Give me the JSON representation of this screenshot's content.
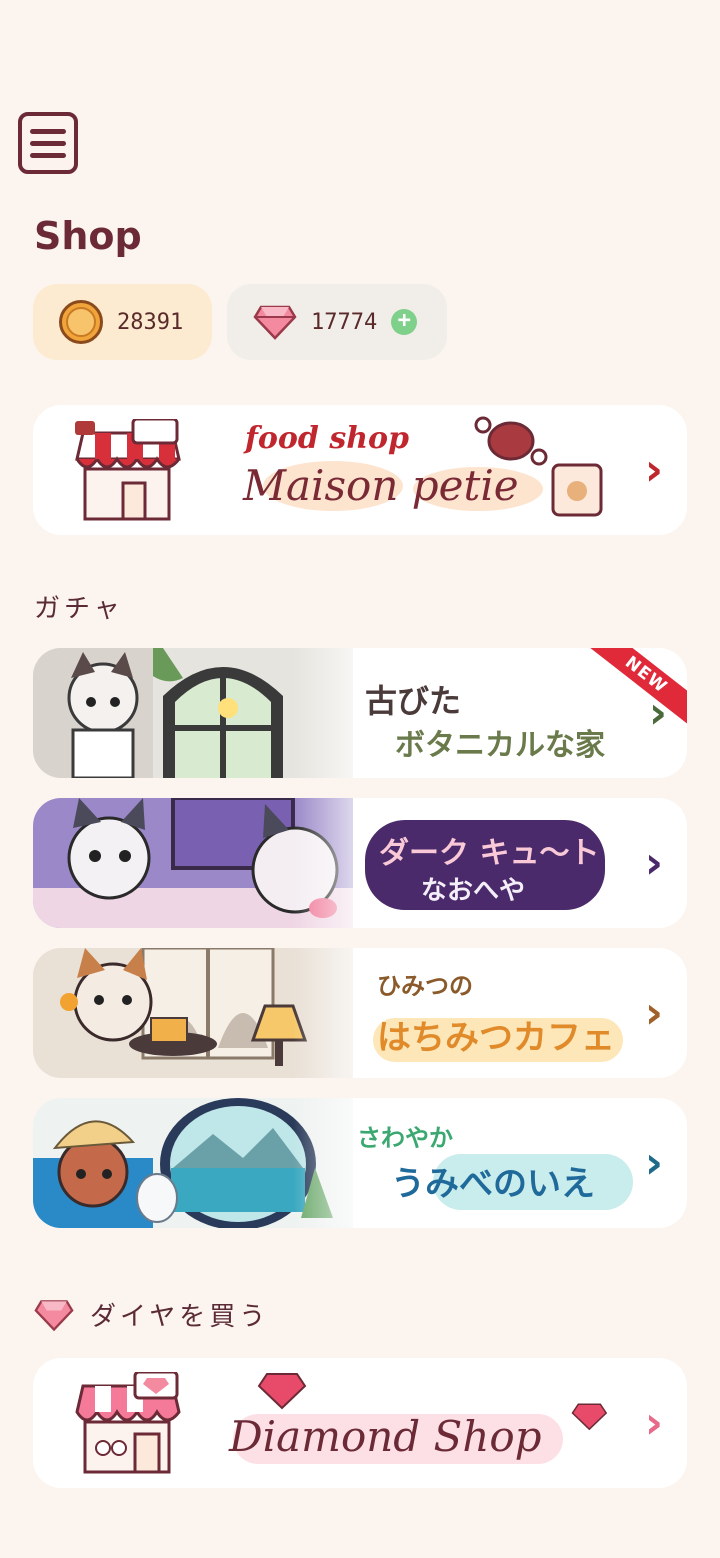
{
  "page": {
    "title": "Shop"
  },
  "currency": {
    "coins": "28391",
    "diamonds": "17774",
    "add_label": "+"
  },
  "food_shop": {
    "small_title": "food shop",
    "big_title": "Maison petie",
    "chevron": "›"
  },
  "gacha": {
    "section_label": "ガチャ",
    "items": [
      {
        "title_line1": "古びた",
        "title_line2": "ボタニカルな家",
        "badge": "NEW",
        "chevron": "›",
        "accent": "#4b6a3a"
      },
      {
        "title_line1": "ダーク キュ～ト",
        "title_line2": "なおへや",
        "chevron": "›",
        "accent": "#4a2a6a"
      },
      {
        "title_line1": "ひみつの",
        "title_line2": "はちみつカフェ",
        "chevron": "›",
        "accent": "#a0602a"
      },
      {
        "title_line1": "さわやか",
        "title_line2": "うみべのいえ",
        "chevron": "›",
        "accent": "#1f6a8a"
      }
    ]
  },
  "diamond_section": {
    "label": "ダイヤを買う",
    "card_title": "Diamond Shop",
    "chevron": "›"
  },
  "colors": {
    "background": "#fcf5ef",
    "brand_dark": "#6b2a35",
    "coin_bg": "#fcebd1",
    "diamond_bg": "#f1eee9",
    "new_ribbon": "#e02a3a"
  }
}
